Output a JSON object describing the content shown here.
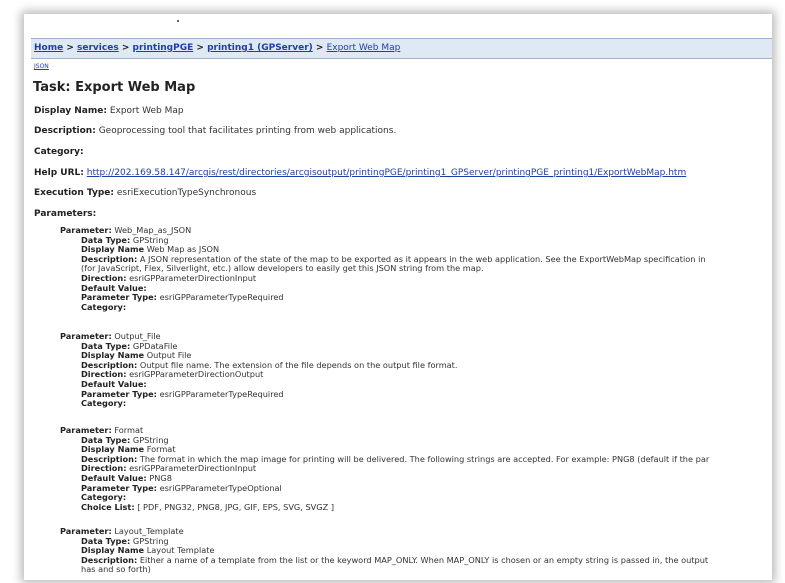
{
  "breadcrumb": {
    "items": [
      "Home",
      "services",
      "printingPGE",
      "printing1 (GPServer)"
    ],
    "separator": ">",
    "current": "Export Web Map"
  },
  "json_link": "JSON",
  "task": {
    "title": "Task: Export Web Map",
    "display_name_label": "Display Name:",
    "display_name": "Export Web Map",
    "description_label": "Description:",
    "description": "Geoprocessing tool that facilitates printing from web applications.",
    "category_label": "Category:",
    "category": "",
    "help_url_label": "Help URL:",
    "help_url": "http://202.169.58.147/arcgis/rest/directories/arcgisoutput/printingPGE/printing1_GPServer/printingPGE_printing1/ExportWebMap.htm",
    "execution_type_label": "Execution Type:",
    "execution_type": "esriExecutionTypeSynchronous",
    "parameters_label": "Parameters:"
  },
  "labels": {
    "parameter": "Parameter:",
    "data_type": "Data Type:",
    "display_name": "Display Name",
    "description": "Description:",
    "direction": "Direction:",
    "default_value": "Default Value:",
    "parameter_type": "Parameter Type:",
    "category": "Category:",
    "choice_list": "Choice List:"
  },
  "parameters": [
    {
      "name": "Web_Map_as_JSON",
      "data_type": "GPString",
      "display_name": "Web Map as JSON",
      "description": "A JSON representation of the state of the map to be exported as it appears in the web application. See the ExportWebMap specification in",
      "description_cont": "(for JavaScript, Flex, Silverlight, etc.) allow developers to easily get this JSON string from the map.",
      "direction": "esriGPParameterDirectionInput",
      "default_value": "",
      "parameter_type": "esriGPParameterTypeRequired",
      "category": ""
    },
    {
      "name": "Output_File",
      "data_type": "GPDataFile",
      "display_name": "Output File",
      "description": "Output file name. The extension of the file depends on the output file format.",
      "direction": "esriGPParameterDirectionOutput",
      "default_value": "",
      "parameter_type": "esriGPParameterTypeRequired",
      "category": ""
    },
    {
      "name": "Format",
      "data_type": "GPString",
      "display_name": "Format",
      "description": "The format in which the map image for printing will be delivered. The following strings are accepted. For example: PNG8 (default if the par",
      "direction": "esriGPParameterDirectionInput",
      "default_value": "PNG8",
      "parameter_type": "esriGPParameterTypeOptional",
      "category": "",
      "choice_list": "[ PDF, PNG32, PNG8, JPG, GIF, EPS, SVG, SVGZ ]"
    },
    {
      "name": "Layout_Template",
      "data_type": "GPString",
      "display_name": "Layout Template",
      "description": "Either a name of a template from the list or the keyword MAP_ONLY. When MAP_ONLY is chosen or an empty string is passed in, the output",
      "description_cont": "has and so forth)"
    }
  ]
}
